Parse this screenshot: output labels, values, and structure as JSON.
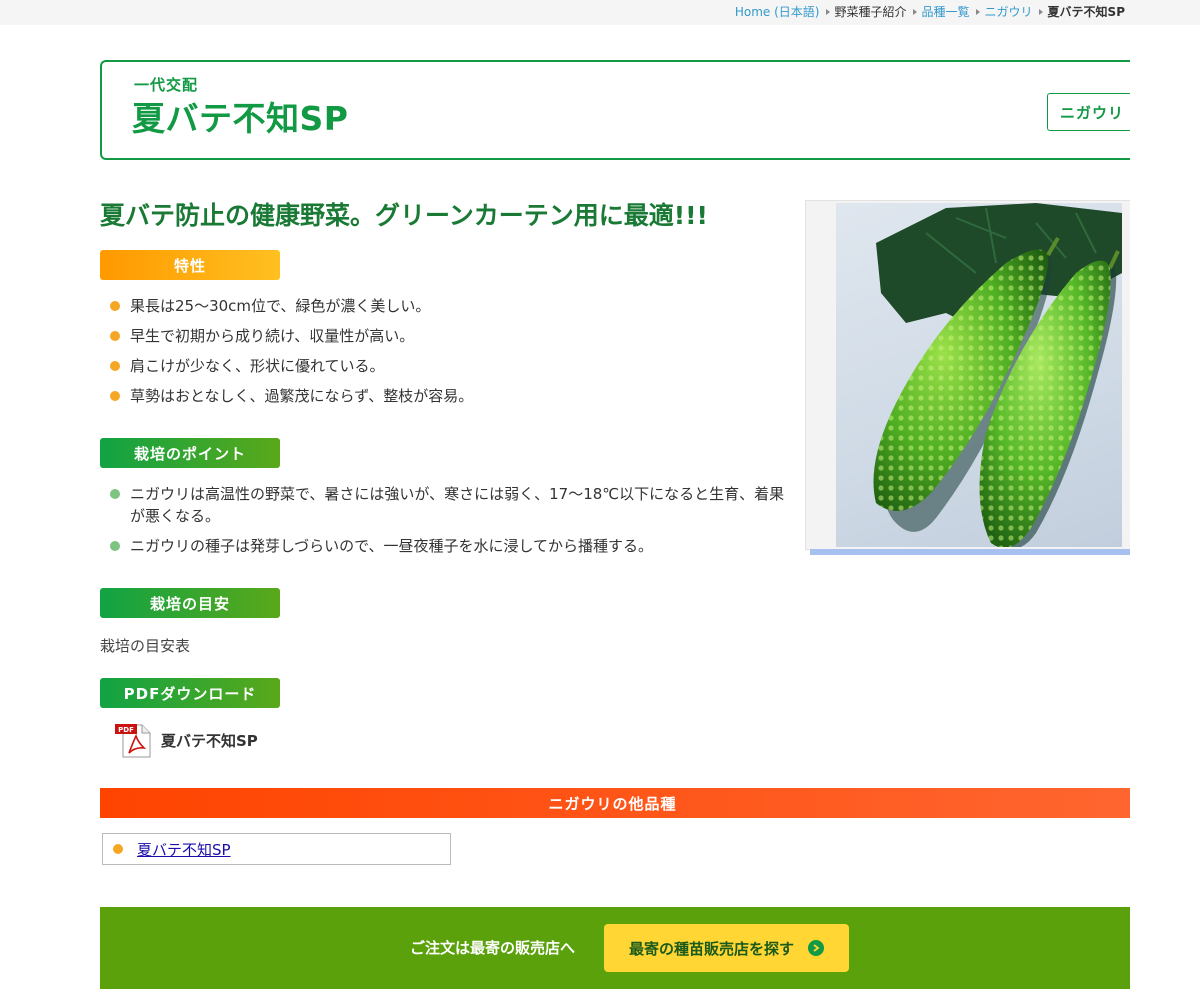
{
  "breadcrumb": {
    "items": [
      {
        "label": "Home (日本語)",
        "style": "link"
      },
      {
        "label": "野菜種子紹介",
        "style": "plain"
      },
      {
        "label": "品種一覧",
        "style": "link"
      },
      {
        "label": "ニガウリ",
        "style": "link"
      },
      {
        "label": "夏バテ不知SP",
        "style": "current"
      }
    ]
  },
  "header": {
    "subtitle": "一代交配",
    "title": "夏バテ不知SP",
    "tag": "ニガウリ"
  },
  "tagline": "夏バテ防止の健康野菜。グリーンカーテン用に最適!!!",
  "features": {
    "label": "特性",
    "items": [
      "果長は25〜30cm位で、緑色が濃く美しい。",
      "早生で初期から成り続け、収量性が高い。",
      "肩こけが少なく、形状に優れている。",
      "草勢はおとなしく、過繁茂にならず、整枝が容易。"
    ]
  },
  "cultivation_points": {
    "label": "栽培のポイント",
    "items": [
      "ニガウリは高温性の野菜で、暑さには強いが、寒さには弱く、17〜18℃以下になると生育、着果が悪くなる。",
      "ニガウリの種子は発芽しづらいので、一昼夜種子を水に浸してから播種する。"
    ]
  },
  "cultivation_guide": {
    "label": "栽培の目安",
    "image_alt": "栽培の目安表"
  },
  "pdf": {
    "label": "PDFダウンロード",
    "icon_text": "PDF",
    "file_label": "夏バテ不知SP"
  },
  "other_varieties": {
    "label": "ニガウリの他品種",
    "items": [
      "夏バテ不知SP"
    ]
  },
  "footer": {
    "text": "ご注文は最寄の販売店へ",
    "button_label": "最寄の種苗販売店を探す"
  },
  "colors": {
    "brand_green": "#119944",
    "accent_orange": "#ff9900",
    "others_red": "#ff4400",
    "footer_green": "#5aa10b",
    "button_yellow": "#ffd633"
  }
}
